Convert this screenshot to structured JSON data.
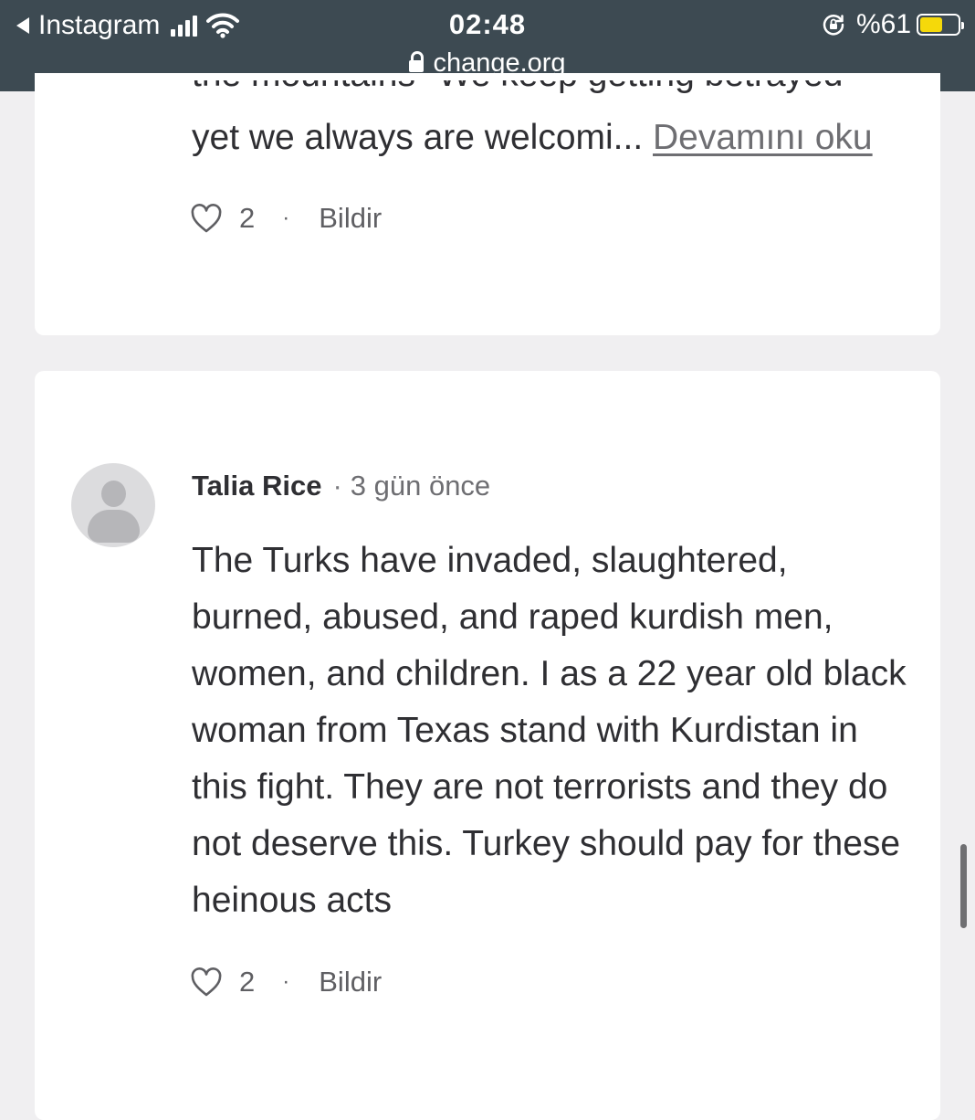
{
  "status_bar": {
    "back_app": "Instagram",
    "time": "02:48",
    "url": "change.org",
    "battery_percent_label": "%61",
    "battery_level": 0.61,
    "battery_color": "#f5d90a",
    "bar_color": "#3d4a52",
    "icons": [
      "back-arrow-icon",
      "cellular-signal-icon",
      "wifi-icon",
      "lock-icon",
      "rotation-lock-icon",
      "battery-icon"
    ]
  },
  "comments": [
    {
      "partial_top_line": "the mountains\" We keep getting betrayed",
      "excerpt": "yet we always are welcomi...",
      "read_more": "Devamını oku",
      "likes": "2",
      "separator": "·",
      "report": "Bildir"
    },
    {
      "author": "Talia Rice",
      "separator": "·",
      "time_ago": "3 gün önce",
      "body": "The Turks have invaded, slaughtered, burned, abused, and raped kurdish men, women, and children. I as a 22 year old black woman from Texas stand with Kurdistan in this fight. They are not terrorists and they do not deserve this. Turkey should pay for these heinous acts",
      "likes": "2",
      "report": "Bildir"
    }
  ]
}
